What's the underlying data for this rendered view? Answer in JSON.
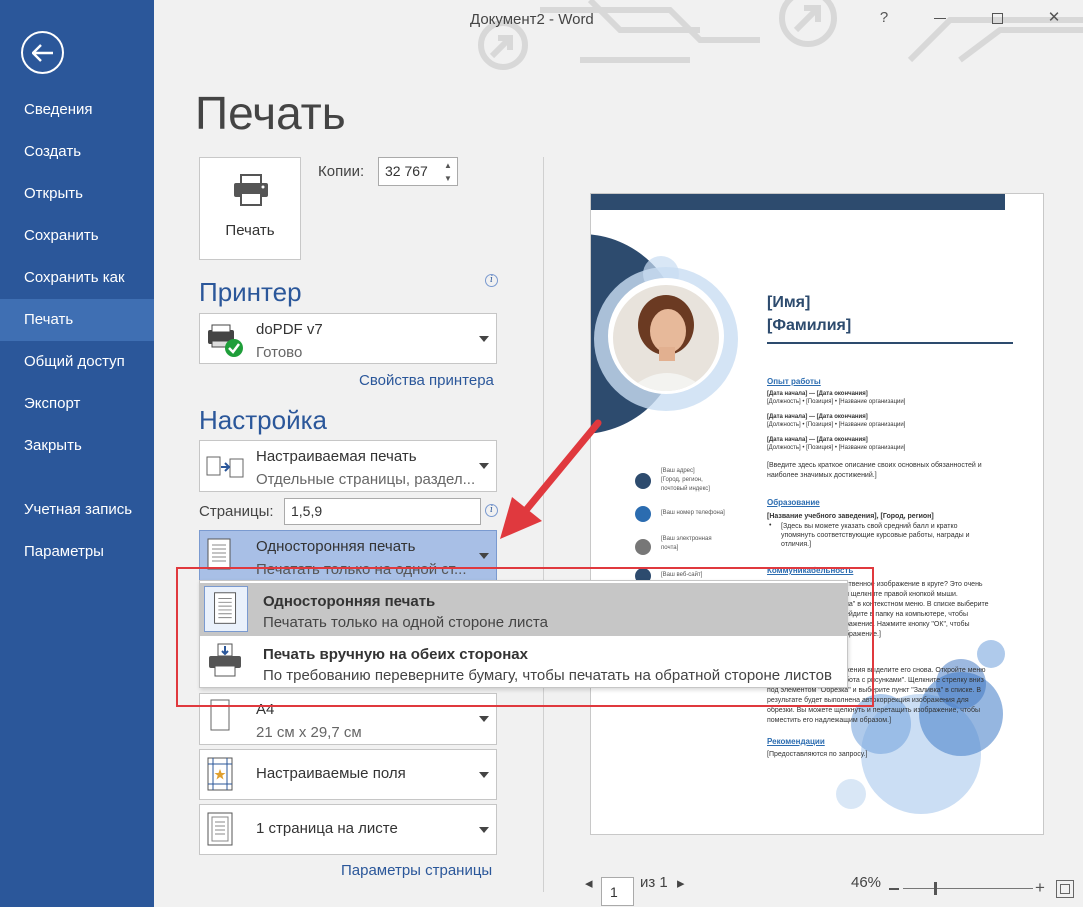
{
  "window": {
    "title": "Документ2 - Word",
    "help": "?",
    "minimize": "—",
    "restore": "☐",
    "close": "✕"
  },
  "sidebar": {
    "items": [
      {
        "label": "Сведения"
      },
      {
        "label": "Создать"
      },
      {
        "label": "Открыть"
      },
      {
        "label": "Сохранить"
      },
      {
        "label": "Сохранить как"
      },
      {
        "label": "Печать",
        "active": true
      },
      {
        "label": "Общий доступ"
      },
      {
        "label": "Экспорт"
      },
      {
        "label": "Закрыть"
      },
      {
        "label": "Учетная запись"
      },
      {
        "label": "Параметры"
      }
    ]
  },
  "page_title": "Печать",
  "print_button": {
    "label": "Печать"
  },
  "copies": {
    "label": "Копии:",
    "value": "32 767"
  },
  "printer": {
    "heading": "Принтер",
    "name": "doPDF v7",
    "status": "Готово",
    "properties_link": "Свойства принтера"
  },
  "settings": {
    "heading": "Настройка",
    "print_range": {
      "title": "Настраиваемая печать",
      "sub": "Отдельные страницы, раздел..."
    },
    "pages_label": "Страницы:",
    "pages_value": "1,5,9",
    "sides": {
      "title": "Односторонняя печать",
      "sub": "Печатать только на одной ст..."
    },
    "paper": {
      "title": "A4",
      "sub": "21 см x 29,7 см"
    },
    "margins": {
      "title": "Настраиваемые поля"
    },
    "per_sheet": {
      "title": "1 страница на листе"
    },
    "page_setup_link": "Параметры страницы"
  },
  "popup": {
    "options": [
      {
        "title": "Односторонняя печать",
        "sub": "Печатать только на одной стороне листа",
        "highlighted": true
      },
      {
        "title": "Печать вручную на обеих сторонах",
        "sub": "По требованию переверните бумагу, чтобы печатать на обратной стороне листов"
      }
    ]
  },
  "preview": {
    "name": "[Имя]",
    "surname": "[Фамилия]",
    "experience_heading": "Опыт работы",
    "job_dates": "[Дата начала] — [Дата окончания]",
    "job_line": "[Должность] • [Позиция] • [Название организации]",
    "job_desc1": "[Введите здесь краткое описание своих основных обязанностей и",
    "job_desc2": "наиболее значимых достижений.]",
    "education_heading": "Образование",
    "edu_line": "[Название учебного заведения], [Город, регион]",
    "edu_b1": "[Здесь вы можете указать свой средний балл и кратко",
    "edu_b2": "упомянуть соответствующие курсовые работы, награды и",
    "edu_b3": "отличия.]",
    "comm_heading": "Коммуникабельность",
    "comm1": "ственное изображение в круге? Это очень",
    "comm2": "и щелкните правой кнопкой мыши.",
    "comm3": "на\" в контекстном меню. В списке выберите",
    "comm4": "ейдите в папку на компьютере, чтобы",
    "comm5": "ражение. Нажмите кнопку \"ОК\", чтобы",
    "comm6": "бражение.]",
    "p2_1": "жения выделите его снова. Откройте меню",
    "p2_2": "бота с рисунками\". Щелкните стрелку вниз",
    "p2_3": "под элементом \"Обрезка\" и выберите пункт \"Заливка\" в списке. В",
    "p2_4": "результате будет выполнена автокоррекция изображения для",
    "p2_5": "обрезки. Вы можете щелкнуть и перетащить изображение, чтобы",
    "p2_6": "поместить его надлежащим образом.]",
    "rec_heading": "Рекомендации",
    "rec_line": "[Предоставляются по запросу.]",
    "contact_addr1": "[Ваш адрес]",
    "contact_addr2": "[Город, регион,",
    "contact_addr3": "почтовый индекс]",
    "contact_phone": "[Ваш номер телефона]",
    "contact_email1": "[Ваш электронная",
    "contact_email2": "почта]",
    "contact_site": "[Ваш веб-сайт]"
  },
  "bottom": {
    "page_value": "1",
    "of_label": "из 1",
    "zoom": "46%"
  },
  "colors": {
    "sidebar": "#2b579a",
    "accent": "#2b579a",
    "highlight_red": "#e0393e"
  }
}
